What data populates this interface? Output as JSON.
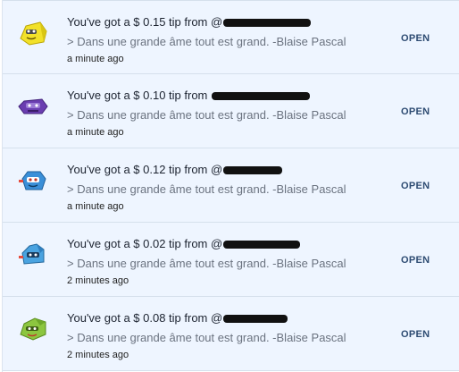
{
  "notifications": [
    {
      "prefix": "You've got a $ 0.15 tip from ",
      "sender_visible": "@",
      "message": "> Dans une grande âme tout est grand. -Blaise Pascal",
      "time": "a minute ago",
      "action": "OPEN",
      "avatar_icon": "yellow-creature-icon",
      "avatar_color": "#f2e12a"
    },
    {
      "prefix": "You've got a $ 0.10 tip from ",
      "sender_visible": "",
      "message": "> Dans une grande âme tout est grand. -Blaise Pascal",
      "time": "a minute ago",
      "action": "OPEN",
      "avatar_icon": "purple-creature-icon",
      "avatar_color": "#6a3db0"
    },
    {
      "prefix": "You've got a $ 0.12 tip from ",
      "sender_visible": "@",
      "message": "> Dans une grande âme tout est grand. -Blaise Pascal",
      "time": "a minute ago",
      "action": "OPEN",
      "avatar_icon": "blue-creature-icon",
      "avatar_color": "#3a8fd8"
    },
    {
      "prefix": "You've got a $ 0.02 tip from ",
      "sender_visible": "@",
      "message": "> Dans une grande âme tout est grand. -Blaise Pascal",
      "time": "2 minutes ago",
      "action": "OPEN",
      "avatar_icon": "blue-creature-icon",
      "avatar_color": "#4aa3e0"
    },
    {
      "prefix": "You've got a $ 0.08 tip from ",
      "sender_visible": "@",
      "message": "> Dans une grande âme tout est grand. -Blaise Pascal",
      "time": "2 minutes ago",
      "action": "OPEN",
      "avatar_icon": "green-creature-icon",
      "avatar_color": "#8cc63f"
    }
  ]
}
